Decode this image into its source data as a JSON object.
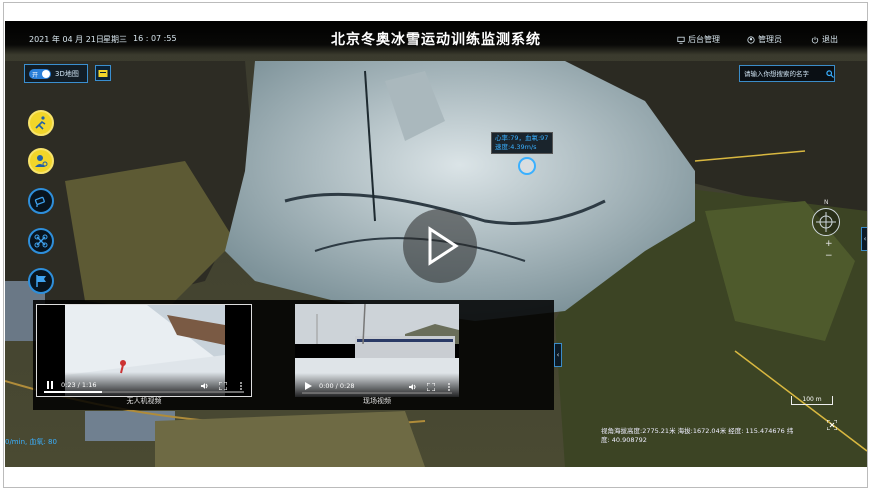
{
  "header": {
    "date": "2021 年 04 月 21日",
    "weekday": "星期三",
    "time": "16 : 07 :55",
    "title": "北京冬奥冰雪运动训练监测系统",
    "backend_label": "后台管理",
    "user_label": "管理员",
    "logout_label": "退出"
  },
  "toolbar": {
    "toggle_on_text": "开",
    "toggle_label": "3D地图",
    "toggle_state": "on"
  },
  "search": {
    "placeholder": "请输入你想搜索的名字"
  },
  "side_buttons": [
    {
      "icon": "skier-icon",
      "style": "yellow"
    },
    {
      "icon": "athlete-icon",
      "style": "yellow"
    },
    {
      "icon": "camera-icon",
      "style": "dark"
    },
    {
      "icon": "drone-icon",
      "style": "dark"
    },
    {
      "icon": "flag-icon",
      "style": "dark"
    }
  ],
  "popup": {
    "line1": "心率:79，血氧:97",
    "line2": "速度:4.39m/s"
  },
  "map_controls": {
    "compass_label": "N",
    "zoom_in": "+",
    "zoom_out": "−"
  },
  "videos": [
    {
      "label": "无人机视频",
      "time": "0:23 / 1:16",
      "state": "playing",
      "progress": 0.29
    },
    {
      "label": "现场视频",
      "time": "0:00 / 0:28",
      "state": "paused",
      "progress": 0.0
    }
  ],
  "status": {
    "left_readout": "0/min,  血氧: 80",
    "scale_label": "100 m",
    "coords_text": "视角海拔高度:2775.21米   海拔:1672.04米   经度: 115.474676  纬度: 40.908792"
  },
  "colors": {
    "accent": "#3ab0ff",
    "marker_yellow": "#f1d52a",
    "border_blue": "#3b8cc8"
  }
}
